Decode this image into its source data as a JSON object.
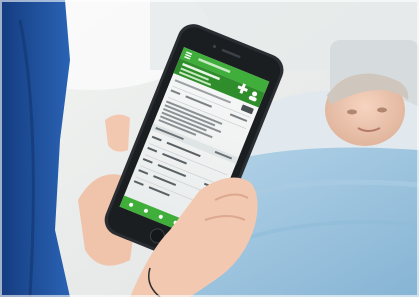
{
  "scene": {
    "description_kind": "photo",
    "colors": {
      "wall": "#e9ecec",
      "pillow": "#dfe6ea",
      "blanket": "#9fc6df",
      "nurse_uniform": "#1f4f9a",
      "phone_body": "#23272b",
      "app_green": "#3fae3a",
      "screen_white": "#f4f5f5",
      "skin": "#f2c5ad"
    },
    "icons": [
      "menu-icon",
      "cross-icon",
      "person-icon",
      "bed-icon"
    ]
  }
}
